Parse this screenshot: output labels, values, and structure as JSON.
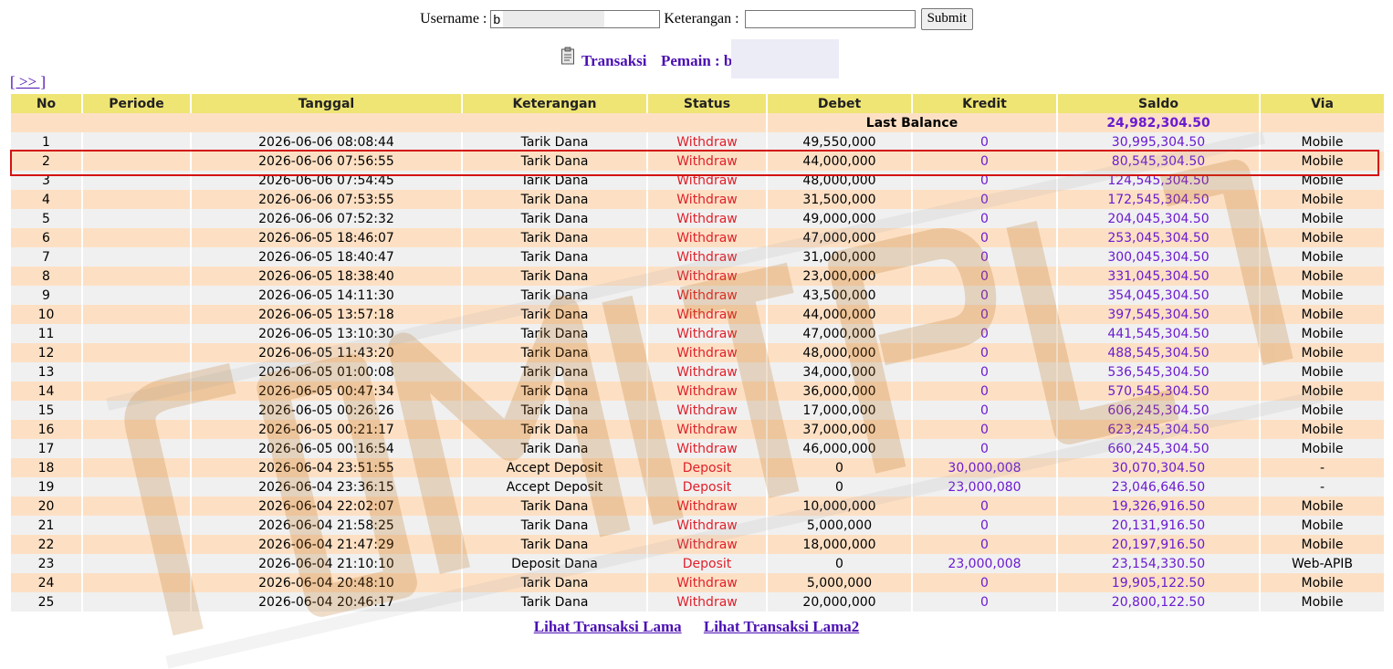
{
  "search": {
    "username_label": "Username :",
    "username_value": "b",
    "keterangan_label": "Keterangan :",
    "keterangan_value": "",
    "submit_label": "Submit"
  },
  "heading": {
    "title": "Transaksi",
    "player_label": "Pemain : b"
  },
  "nav": {
    "next_label": "[ >> ]"
  },
  "table": {
    "columns": [
      "No",
      "Periode",
      "Tanggal",
      "Keterangan",
      "Status",
      "Debet",
      "Kredit",
      "Saldo",
      "Via"
    ],
    "last_balance_label": "Last Balance",
    "last_balance_value": "24,982,304.50",
    "rows": [
      {
        "no": "1",
        "periode": "",
        "tanggal": "2026-06-06 08:08:44",
        "keterangan": "Tarik Dana",
        "status": "Withdraw",
        "debet": "49,550,000",
        "kredit": "0",
        "saldo": "30,995,304.50",
        "via": "Mobile"
      },
      {
        "no": "2",
        "periode": "",
        "tanggal": "2026-06-06 07:56:55",
        "keterangan": "Tarik Dana",
        "status": "Withdraw",
        "debet": "44,000,000",
        "kredit": "0",
        "saldo": "80,545,304.50",
        "via": "Mobile"
      },
      {
        "no": "3",
        "periode": "",
        "tanggal": "2026-06-06 07:54:45",
        "keterangan": "Tarik Dana",
        "status": "Withdraw",
        "debet": "48,000,000",
        "kredit": "0",
        "saldo": "124,545,304.50",
        "via": "Mobile"
      },
      {
        "no": "4",
        "periode": "",
        "tanggal": "2026-06-06 07:53:55",
        "keterangan": "Tarik Dana",
        "status": "Withdraw",
        "debet": "31,500,000",
        "kredit": "0",
        "saldo": "172,545,304.50",
        "via": "Mobile"
      },
      {
        "no": "5",
        "periode": "",
        "tanggal": "2026-06-06 07:52:32",
        "keterangan": "Tarik Dana",
        "status": "Withdraw",
        "debet": "49,000,000",
        "kredit": "0",
        "saldo": "204,045,304.50",
        "via": "Mobile"
      },
      {
        "no": "6",
        "periode": "",
        "tanggal": "2026-06-05 18:46:07",
        "keterangan": "Tarik Dana",
        "status": "Withdraw",
        "debet": "47,000,000",
        "kredit": "0",
        "saldo": "253,045,304.50",
        "via": "Mobile"
      },
      {
        "no": "7",
        "periode": "",
        "tanggal": "2026-06-05 18:40:47",
        "keterangan": "Tarik Dana",
        "status": "Withdraw",
        "debet": "31,000,000",
        "kredit": "0",
        "saldo": "300,045,304.50",
        "via": "Mobile"
      },
      {
        "no": "8",
        "periode": "",
        "tanggal": "2026-06-05 18:38:40",
        "keterangan": "Tarik Dana",
        "status": "Withdraw",
        "debet": "23,000,000",
        "kredit": "0",
        "saldo": "331,045,304.50",
        "via": "Mobile"
      },
      {
        "no": "9",
        "periode": "",
        "tanggal": "2026-06-05 14:11:30",
        "keterangan": "Tarik Dana",
        "status": "Withdraw",
        "debet": "43,500,000",
        "kredit": "0",
        "saldo": "354,045,304.50",
        "via": "Mobile"
      },
      {
        "no": "10",
        "periode": "",
        "tanggal": "2026-06-05 13:57:18",
        "keterangan": "Tarik Dana",
        "status": "Withdraw",
        "debet": "44,000,000",
        "kredit": "0",
        "saldo": "397,545,304.50",
        "via": "Mobile"
      },
      {
        "no": "11",
        "periode": "",
        "tanggal": "2026-06-05 13:10:30",
        "keterangan": "Tarik Dana",
        "status": "Withdraw",
        "debet": "47,000,000",
        "kredit": "0",
        "saldo": "441,545,304.50",
        "via": "Mobile"
      },
      {
        "no": "12",
        "periode": "",
        "tanggal": "2026-06-05 11:43:20",
        "keterangan": "Tarik Dana",
        "status": "Withdraw",
        "debet": "48,000,000",
        "kredit": "0",
        "saldo": "488,545,304.50",
        "via": "Mobile"
      },
      {
        "no": "13",
        "periode": "",
        "tanggal": "2026-06-05 01:00:08",
        "keterangan": "Tarik Dana",
        "status": "Withdraw",
        "debet": "34,000,000",
        "kredit": "0",
        "saldo": "536,545,304.50",
        "via": "Mobile"
      },
      {
        "no": "14",
        "periode": "",
        "tanggal": "2026-06-05 00:47:34",
        "keterangan": "Tarik Dana",
        "status": "Withdraw",
        "debet": "36,000,000",
        "kredit": "0",
        "saldo": "570,545,304.50",
        "via": "Mobile"
      },
      {
        "no": "15",
        "periode": "",
        "tanggal": "2026-06-05 00:26:26",
        "keterangan": "Tarik Dana",
        "status": "Withdraw",
        "debet": "17,000,000",
        "kredit": "0",
        "saldo": "606,245,304.50",
        "via": "Mobile"
      },
      {
        "no": "16",
        "periode": "",
        "tanggal": "2026-06-05 00:21:17",
        "keterangan": "Tarik Dana",
        "status": "Withdraw",
        "debet": "37,000,000",
        "kredit": "0",
        "saldo": "623,245,304.50",
        "via": "Mobile"
      },
      {
        "no": "17",
        "periode": "",
        "tanggal": "2026-06-05 00:16:54",
        "keterangan": "Tarik Dana",
        "status": "Withdraw",
        "debet": "46,000,000",
        "kredit": "0",
        "saldo": "660,245,304.50",
        "via": "Mobile"
      },
      {
        "no": "18",
        "periode": "",
        "tanggal": "2026-06-04 23:51:55",
        "keterangan": "Accept Deposit",
        "status": "Deposit",
        "debet": "0",
        "kredit": "30,000,008",
        "saldo": "30,070,304.50",
        "via": "-"
      },
      {
        "no": "19",
        "periode": "",
        "tanggal": "2026-06-04 23:36:15",
        "keterangan": "Accept Deposit",
        "status": "Deposit",
        "debet": "0",
        "kredit": "23,000,080",
        "saldo": "23,046,646.50",
        "via": "-"
      },
      {
        "no": "20",
        "periode": "",
        "tanggal": "2026-06-04 22:02:07",
        "keterangan": "Tarik Dana",
        "status": "Withdraw",
        "debet": "10,000,000",
        "kredit": "0",
        "saldo": "19,326,916.50",
        "via": "Mobile"
      },
      {
        "no": "21",
        "periode": "",
        "tanggal": "2026-06-04 21:58:25",
        "keterangan": "Tarik Dana",
        "status": "Withdraw",
        "debet": "5,000,000",
        "kredit": "0",
        "saldo": "20,131,916.50",
        "via": "Mobile"
      },
      {
        "no": "22",
        "periode": "",
        "tanggal": "2026-06-04 21:47:29",
        "keterangan": "Tarik Dana",
        "status": "Withdraw",
        "debet": "18,000,000",
        "kredit": "0",
        "saldo": "20,197,916.50",
        "via": "Mobile"
      },
      {
        "no": "23",
        "periode": "",
        "tanggal": "2026-06-04 21:10:10",
        "keterangan": "Deposit Dana",
        "status": "Deposit",
        "debet": "0",
        "kredit": "23,000,008",
        "saldo": "23,154,330.50",
        "via": "Web-APIB"
      },
      {
        "no": "24",
        "periode": "",
        "tanggal": "2026-06-04 20:48:10",
        "keterangan": "Tarik Dana",
        "status": "Withdraw",
        "debet": "5,000,000",
        "kredit": "0",
        "saldo": "19,905,122.50",
        "via": "Mobile"
      },
      {
        "no": "25",
        "periode": "",
        "tanggal": "2026-06-04 20:46:17",
        "keterangan": "Tarik Dana",
        "status": "Withdraw",
        "debet": "20,000,000",
        "kredit": "0",
        "saldo": "20,800,122.50",
        "via": "Mobile"
      }
    ]
  },
  "footer": {
    "link1": "Lihat Transaksi Lama",
    "link2": "Lihat Transaksi Lama2"
  },
  "colors": {
    "header_bg": "#efe574",
    "row_alt_bg": "#fde0c4",
    "row_bg": "#f0f0f0",
    "status_red": "#e0202a",
    "link_purple": "#4b0fb3",
    "highlight_red": "#d41212"
  },
  "icons": {
    "heading_icon": "clipboard-icon"
  }
}
